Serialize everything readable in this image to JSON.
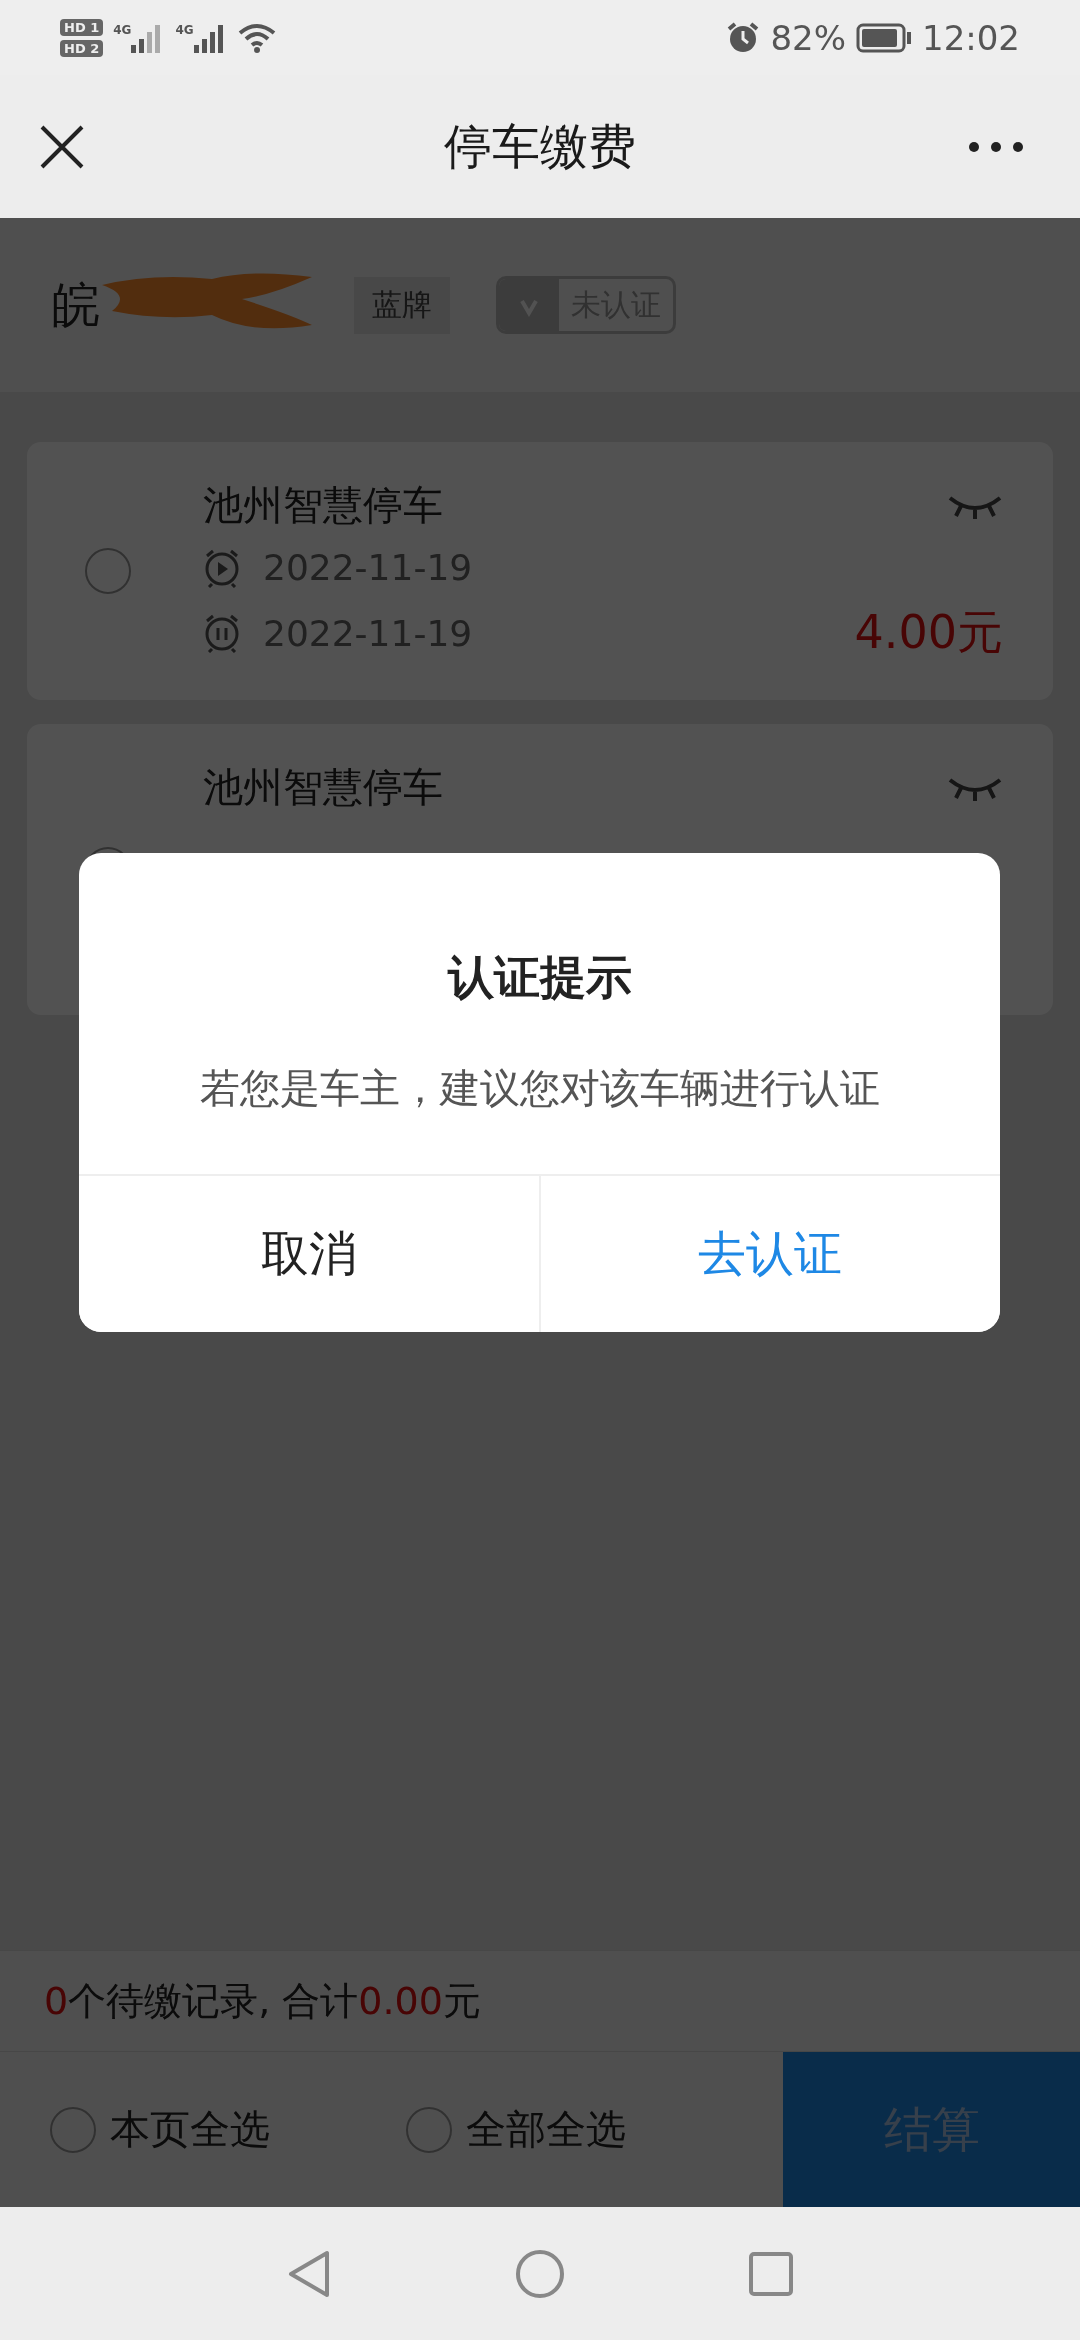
{
  "status_bar": {
    "sims": [
      {
        "label": "HD",
        "slot": "1"
      },
      {
        "label": "HD",
        "slot": "2"
      }
    ],
    "networks": [
      "4G",
      "4G"
    ],
    "battery": "82%",
    "time": "12:02"
  },
  "header": {
    "title": "停车缴费"
  },
  "vehicle": {
    "plate": "皖",
    "plate_type": "蓝牌",
    "verification": "未认证",
    "verified": false
  },
  "records": [
    {
      "name": "池州智慧停车",
      "start": "2022-11-19",
      "end": "2022-11-19",
      "amount": "4.00元",
      "selected": false
    },
    {
      "name": "池州智慧停车",
      "selected": false
    }
  ],
  "summary": {
    "count": "0",
    "text": "个待缴记录, 合计",
    "total": "0.00",
    "unit": "元"
  },
  "select_options": [
    {
      "label": "本页全选",
      "selected": false
    },
    {
      "label": "全部全选",
      "selected": false
    }
  ],
  "checkout": "结算",
  "dialog": {
    "title": "认证提示",
    "message": "若您是车主，建议您对该车辆进行认证",
    "buttons": [
      {
        "label": "取消",
        "kind": "cancel"
      },
      {
        "label": "去认证",
        "kind": "primary"
      }
    ]
  }
}
